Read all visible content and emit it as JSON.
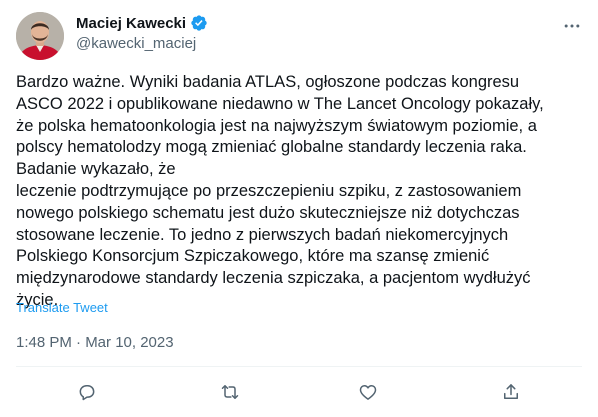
{
  "author": {
    "name": "Maciej Kawecki",
    "handle": "@kawecki_maciej",
    "verified": true
  },
  "tweet": {
    "text": "Bardzo ważne. Wyniki badania ATLAS, ogłoszone podczas kongresu\nASCO 2022 i opublikowane niedawno w The Lancet Oncology pokazały,\nże polska hematoonkologia jest na najwyższym światowym poziomie, a\npolscy hematolodzy mogą zmieniać globalne standardy leczenia raka.\nBadanie wykazało, że\nleczenie podtrzymujące po przeszczepieniu szpiku, z zastosowaniem\nnowego polskiego schematu jest dużo skuteczniejsze niż dotychczas\nstosowane leczenie. To jedno z pierwszych badań niekomercyjnych\nPolskiego Konsorcjum Szpiczakowego, które ma szansę zmienić\nmiędzynarodowe standardy leczenia szpiczaka, a pacjentom wydłużyć\nżycie.",
    "translate_label": "Translate Tweet",
    "timestamp": "1:48 PM · Mar 10, 2023"
  },
  "actions": [
    "reply-icon",
    "retweet-icon",
    "like-icon",
    "share-icon"
  ],
  "colors": {
    "text": "#0f1419",
    "secondary": "#536471",
    "link": "#1d9bf0",
    "verified": "#1d9bf0",
    "divider": "#eff3f4"
  }
}
